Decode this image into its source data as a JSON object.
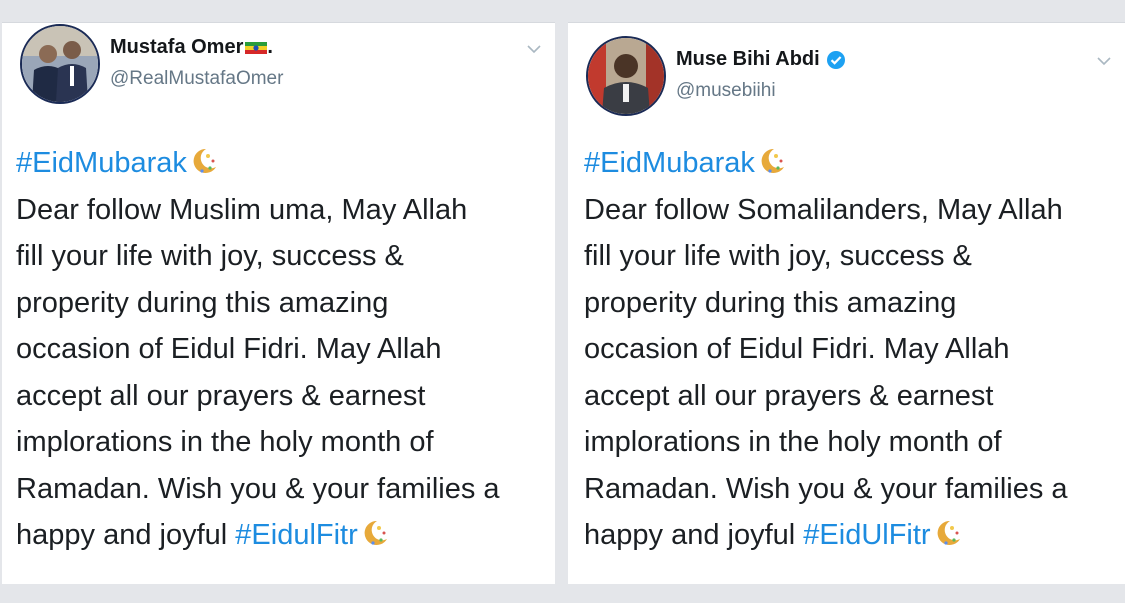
{
  "tweets": [
    {
      "display_name": "Mustafa Omer",
      "name_suffix": ".",
      "handle": "@RealMustafaOmer",
      "hashtag_line": "#EidMubarak",
      "lines": [
        "Dear follow Muslim uma, May Allah",
        "fill your life with joy, success &",
        "properity during this amazing",
        "occasion of Eidul Fidri. May Allah",
        "accept all our prayers & earnest",
        "implorations in the holy month of",
        "Ramadan. Wish you & your families a"
      ],
      "last_line_prefix": "happy and joyful ",
      "last_hashtag": "#EidulFitr",
      "flag_icon": "ethiopia-flag-icon",
      "emoji_icon": "crescent-moon-stars-icon"
    },
    {
      "display_name": "Muse Bihi Abdi",
      "handle": "@musebiihi",
      "hashtag_line": "#EidMubarak",
      "lines": [
        "Dear follow Somalilanders, May Allah",
        "fill your life with joy, success &",
        "properity during this amazing",
        "occasion of Eidul Fidri. May Allah",
        "accept all our prayers & earnest",
        "implorations in the holy month of",
        "Ramadan. Wish you & your families a"
      ],
      "last_line_prefix": "happy and joyful ",
      "last_hashtag": "#EidUlFitr",
      "badge_icon": "verified-badge-icon",
      "emoji_icon": "crescent-moon-stars-icon"
    }
  ],
  "colors": {
    "hashtag": "#1d8ce0",
    "text": "#1b1f23",
    "handle": "#657786",
    "verified": "#1da1f2"
  }
}
